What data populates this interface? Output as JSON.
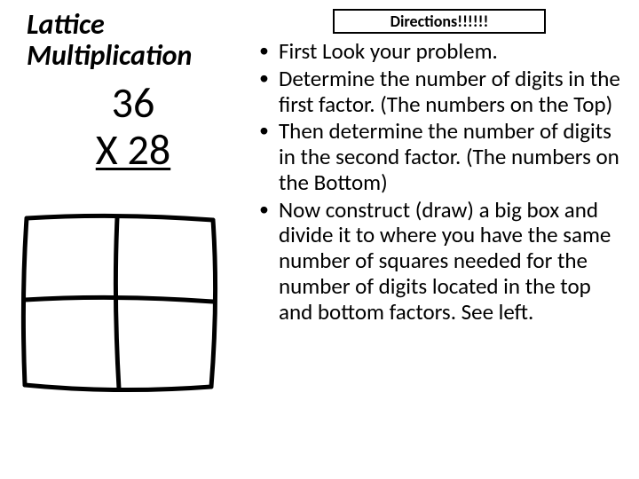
{
  "title": "Lattice Multiplication",
  "problem": {
    "first_factor": "36",
    "second_line": "X  28"
  },
  "directions": {
    "heading": "Directions!!!!!!",
    "bullets": [
      "First Look your problem.",
      "Determine the number of digits in the first factor. (The numbers on the Top)",
      "Then determine the number of digits in the second factor. (The numbers on the Bottom)",
      "Now construct (draw) a big box and divide it to where you have the same number of squares needed for the number of digits located in the top and bottom factors. See left."
    ]
  }
}
